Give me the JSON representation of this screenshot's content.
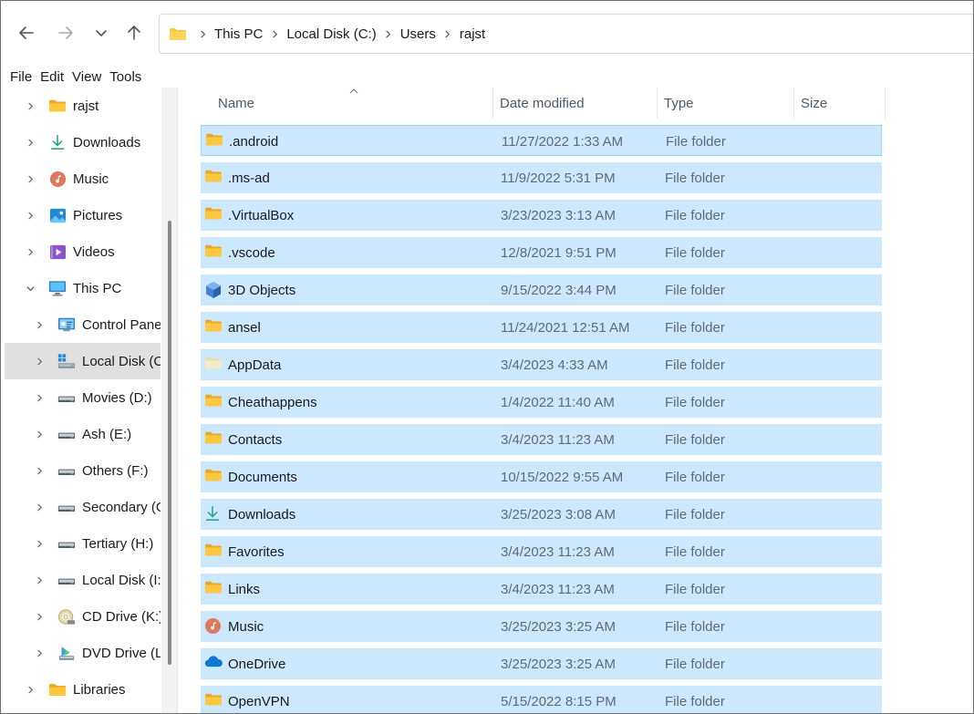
{
  "breadcrumb": [
    "This PC",
    "Local Disk (C:)",
    "Users",
    "rajst"
  ],
  "menu": [
    "File",
    "Edit",
    "View",
    "Tools"
  ],
  "sidebar": [
    {
      "label": "rajst",
      "icon": "folder-icon",
      "level": 0,
      "expanded": false
    },
    {
      "label": "Downloads",
      "icon": "download-icon",
      "level": 0,
      "expanded": false
    },
    {
      "label": "Music",
      "icon": "music-icon",
      "level": 0,
      "expanded": false
    },
    {
      "label": "Pictures",
      "icon": "pictures-icon",
      "level": 0,
      "expanded": false
    },
    {
      "label": "Videos",
      "icon": "videos-icon",
      "level": 0,
      "expanded": false
    },
    {
      "label": "This PC",
      "icon": "computer-icon",
      "level": 0,
      "expanded": true
    },
    {
      "label": "Control Panel",
      "icon": "control-panel-icon",
      "level": 1,
      "expanded": false
    },
    {
      "label": "Local Disk (C:)",
      "icon": "windows-drive-icon",
      "level": 1,
      "expanded": false,
      "selected": true
    },
    {
      "label": "Movies (D:)",
      "icon": "drive-icon",
      "level": 1,
      "expanded": false
    },
    {
      "label": "Ash (E:)",
      "icon": "drive-icon",
      "level": 1,
      "expanded": false
    },
    {
      "label": "Others (F:)",
      "icon": "drive-icon",
      "level": 1,
      "expanded": false
    },
    {
      "label": "Secondary (G:)",
      "icon": "drive-icon",
      "level": 1,
      "expanded": false
    },
    {
      "label": "Tertiary (H:)",
      "icon": "drive-icon",
      "level": 1,
      "expanded": false
    },
    {
      "label": "Local Disk (I:)",
      "icon": "drive-icon",
      "level": 1,
      "expanded": false
    },
    {
      "label": "CD Drive (K:)",
      "icon": "cd-drive-icon",
      "level": 1,
      "expanded": false
    },
    {
      "label": "DVD Drive (L:)",
      "icon": "dvd-drive-icon",
      "level": 1,
      "expanded": false
    },
    {
      "label": "Libraries",
      "icon": "libraries-icon",
      "level": 0,
      "expanded": false
    }
  ],
  "columns": [
    "Name",
    "Date modified",
    "Type",
    "Size"
  ],
  "files": [
    {
      "name": ".android",
      "date": "11/27/2022 1:33 AM",
      "type": "File folder",
      "size": "",
      "icon": "folder-icon",
      "focused": true
    },
    {
      "name": ".ms-ad",
      "date": "11/9/2022 5:31 PM",
      "type": "File folder",
      "size": "",
      "icon": "folder-icon"
    },
    {
      "name": ".VirtualBox",
      "date": "3/23/2023 3:13 AM",
      "type": "File folder",
      "size": "",
      "icon": "folder-icon"
    },
    {
      "name": ".vscode",
      "date": "12/8/2021 9:51 PM",
      "type": "File folder",
      "size": "",
      "icon": "folder-icon"
    },
    {
      "name": "3D Objects",
      "date": "9/15/2022 3:44 PM",
      "type": "File folder",
      "size": "",
      "icon": "3d-objects-icon"
    },
    {
      "name": "ansel",
      "date": "11/24/2021 12:51 AM",
      "type": "File folder",
      "size": "",
      "icon": "folder-icon"
    },
    {
      "name": "AppData",
      "date": "3/4/2023 4:33 AM",
      "type": "File folder",
      "size": "",
      "icon": "hidden-folder-icon"
    },
    {
      "name": "Cheathappens",
      "date": "1/4/2022 11:40 AM",
      "type": "File folder",
      "size": "",
      "icon": "folder-icon"
    },
    {
      "name": "Contacts",
      "date": "3/4/2023 11:23 AM",
      "type": "File folder",
      "size": "",
      "icon": "folder-icon"
    },
    {
      "name": "Documents",
      "date": "10/15/2022 9:55 AM",
      "type": "File folder",
      "size": "",
      "icon": "folder-icon"
    },
    {
      "name": "Downloads",
      "date": "3/25/2023 3:08 AM",
      "type": "File folder",
      "size": "",
      "icon": "download-icon"
    },
    {
      "name": "Favorites",
      "date": "3/4/2023 11:23 AM",
      "type": "File folder",
      "size": "",
      "icon": "folder-icon"
    },
    {
      "name": "Links",
      "date": "3/4/2023 11:23 AM",
      "type": "File folder",
      "size": "",
      "icon": "folder-icon"
    },
    {
      "name": "Music",
      "date": "3/25/2023 3:25 AM",
      "type": "File folder",
      "size": "",
      "icon": "music-icon"
    },
    {
      "name": "OneDrive",
      "date": "3/25/2023 3:25 AM",
      "type": "File folder",
      "size": "",
      "icon": "onedrive-icon"
    },
    {
      "name": "OpenVPN",
      "date": "5/15/2022 8:15 PM",
      "type": "File folder",
      "size": "",
      "icon": "folder-icon"
    }
  ],
  "colors": {
    "selection": "#cce8ff",
    "selection_border": "#99d1ff",
    "folder": "#ffc83d",
    "sidebar_selected": "#e0e0e0"
  }
}
